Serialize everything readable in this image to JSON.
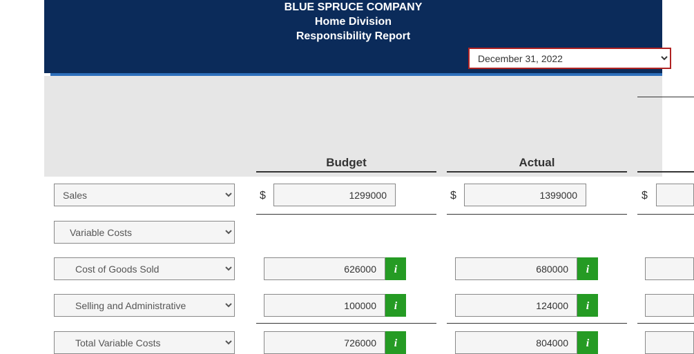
{
  "header": {
    "company": "BLUE SPRUCE COMPANY",
    "division": "Home Division",
    "report": "Responsibility Report",
    "date_option": "December 31, 2022"
  },
  "columns": {
    "budget": "Budget",
    "actual": "Actual"
  },
  "currency_symbol": "$",
  "info_icon": "i",
  "rows": {
    "sales": {
      "label": "Sales",
      "budget": "1299000",
      "actual": "1399000"
    },
    "variable_costs": {
      "label": "Variable Costs"
    },
    "cogs": {
      "label": "Cost of Goods Sold",
      "budget": "626000",
      "actual": "680000"
    },
    "selling_admin": {
      "label": "Selling and Administrative",
      "budget": "100000",
      "actual": "124000"
    },
    "total_variable": {
      "label": "Total Variable Costs",
      "budget": "726000",
      "actual": "804000"
    }
  }
}
